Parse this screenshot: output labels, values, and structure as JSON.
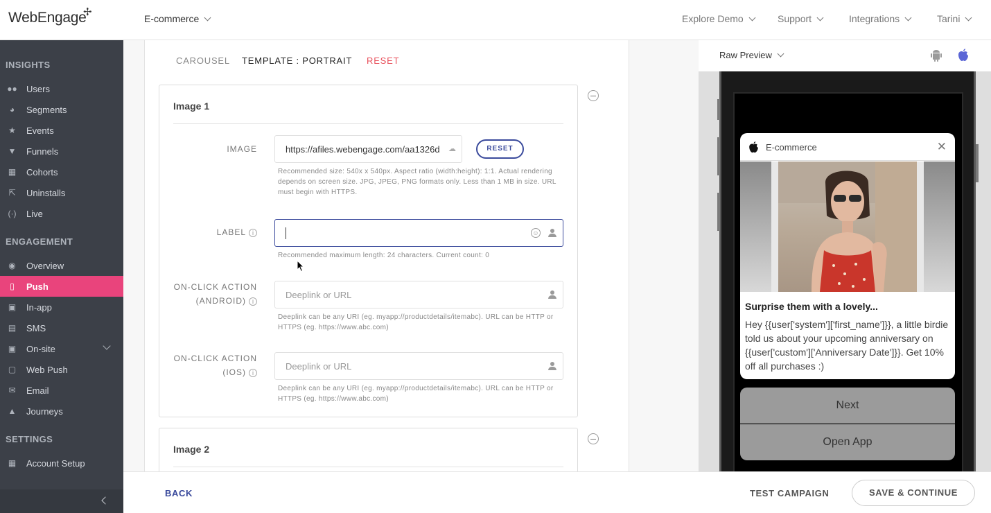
{
  "brand": {
    "name": "WebEngage"
  },
  "header": {
    "project": "E-commerce",
    "nav": [
      {
        "label": "Explore Demo"
      },
      {
        "label": "Support"
      },
      {
        "label": "Integrations"
      },
      {
        "label": "Tarini"
      }
    ]
  },
  "sidebar": {
    "sections": {
      "insights": "INSIGHTS",
      "engagement": "ENGAGEMENT",
      "settings": "SETTINGS"
    },
    "insights": [
      {
        "label": "Users",
        "icon": "users-icon"
      },
      {
        "label": "Segments",
        "icon": "segments-icon"
      },
      {
        "label": "Events",
        "icon": "star-icon"
      },
      {
        "label": "Funnels",
        "icon": "funnel-icon"
      },
      {
        "label": "Cohorts",
        "icon": "cohorts-icon"
      },
      {
        "label": "Uninstalls",
        "icon": "uninstall-icon"
      },
      {
        "label": "Live",
        "icon": "live-icon"
      }
    ],
    "engagement": [
      {
        "label": "Overview",
        "icon": "eye-icon"
      },
      {
        "label": "Push",
        "icon": "push-icon",
        "active": true
      },
      {
        "label": "In-app",
        "icon": "in-app-icon"
      },
      {
        "label": "SMS",
        "icon": "sms-icon"
      },
      {
        "label": "On-site",
        "icon": "on-site-icon"
      },
      {
        "label": "Web Push",
        "icon": "web-push-icon"
      },
      {
        "label": "Email",
        "icon": "email-icon"
      },
      {
        "label": "Journeys",
        "icon": "rocket-icon"
      }
    ],
    "settings": [
      {
        "label": "Account Setup",
        "icon": "grid-icon"
      }
    ]
  },
  "editor": {
    "tabs": {
      "carousel": "CAROUSEL",
      "template": "TEMPLATE : PORTRAIT",
      "reset": "RESET"
    },
    "image1": {
      "title": "Image 1",
      "image_label": "IMAGE",
      "image_value": "https://afiles.webengage.com/aa1326d",
      "reset_btn": "RESET",
      "image_help": "Recommended size: 540x x 540px. Aspect ratio (width:height): 1:1. Actual rendering depends on screen size. JPG, JPEG, PNG formats only. Less than 1 MB in size. URL must begin with HTTPS.",
      "label_label": "LABEL",
      "label_value": "",
      "label_help": "Recommended maximum length: 24 characters. Current count: 0",
      "android_label_1": "ON-CLICK ACTION",
      "android_label_2": "(ANDROID)",
      "android_placeholder": "Deeplink or URL",
      "android_help": "Deeplink can be any URI (eg. myapp://productdetails/itemabc). URL can be HTTP or HTTPS (eg. https://www.abc.com)",
      "ios_label_1": "ON-CLICK ACTION",
      "ios_label_2": "(IOS)",
      "ios_placeholder": "Deeplink or URL",
      "ios_help": "Deeplink can be any URI (eg. myapp://productdetails/itemabc). URL can be HTTP or HTTPS (eg. https://www.abc.com)"
    },
    "image2": {
      "title": "Image 2"
    }
  },
  "preview": {
    "mode": "Raw Preview",
    "platforms": [
      "android-icon",
      "apple-icon"
    ],
    "notification": {
      "app": "E-commerce",
      "title": "Surprise them with a lovely...",
      "body": "Hey {{user['system']['first_name']}}, a little birdie told us about your upcoming anniversary on {{user['custom']['Anniversary Date']}}. Get 10% off all purchases :)",
      "actions": [
        "Next",
        "Open App"
      ]
    }
  },
  "footer": {
    "back": "BACK",
    "test": "TEST CAMPAIGN",
    "save": "SAVE & CONTINUE"
  },
  "colors": {
    "accent": "#3a4a9c",
    "active_nav": "#e9447c",
    "reset_red": "#e8505b",
    "sidebar": "#3c4048"
  }
}
